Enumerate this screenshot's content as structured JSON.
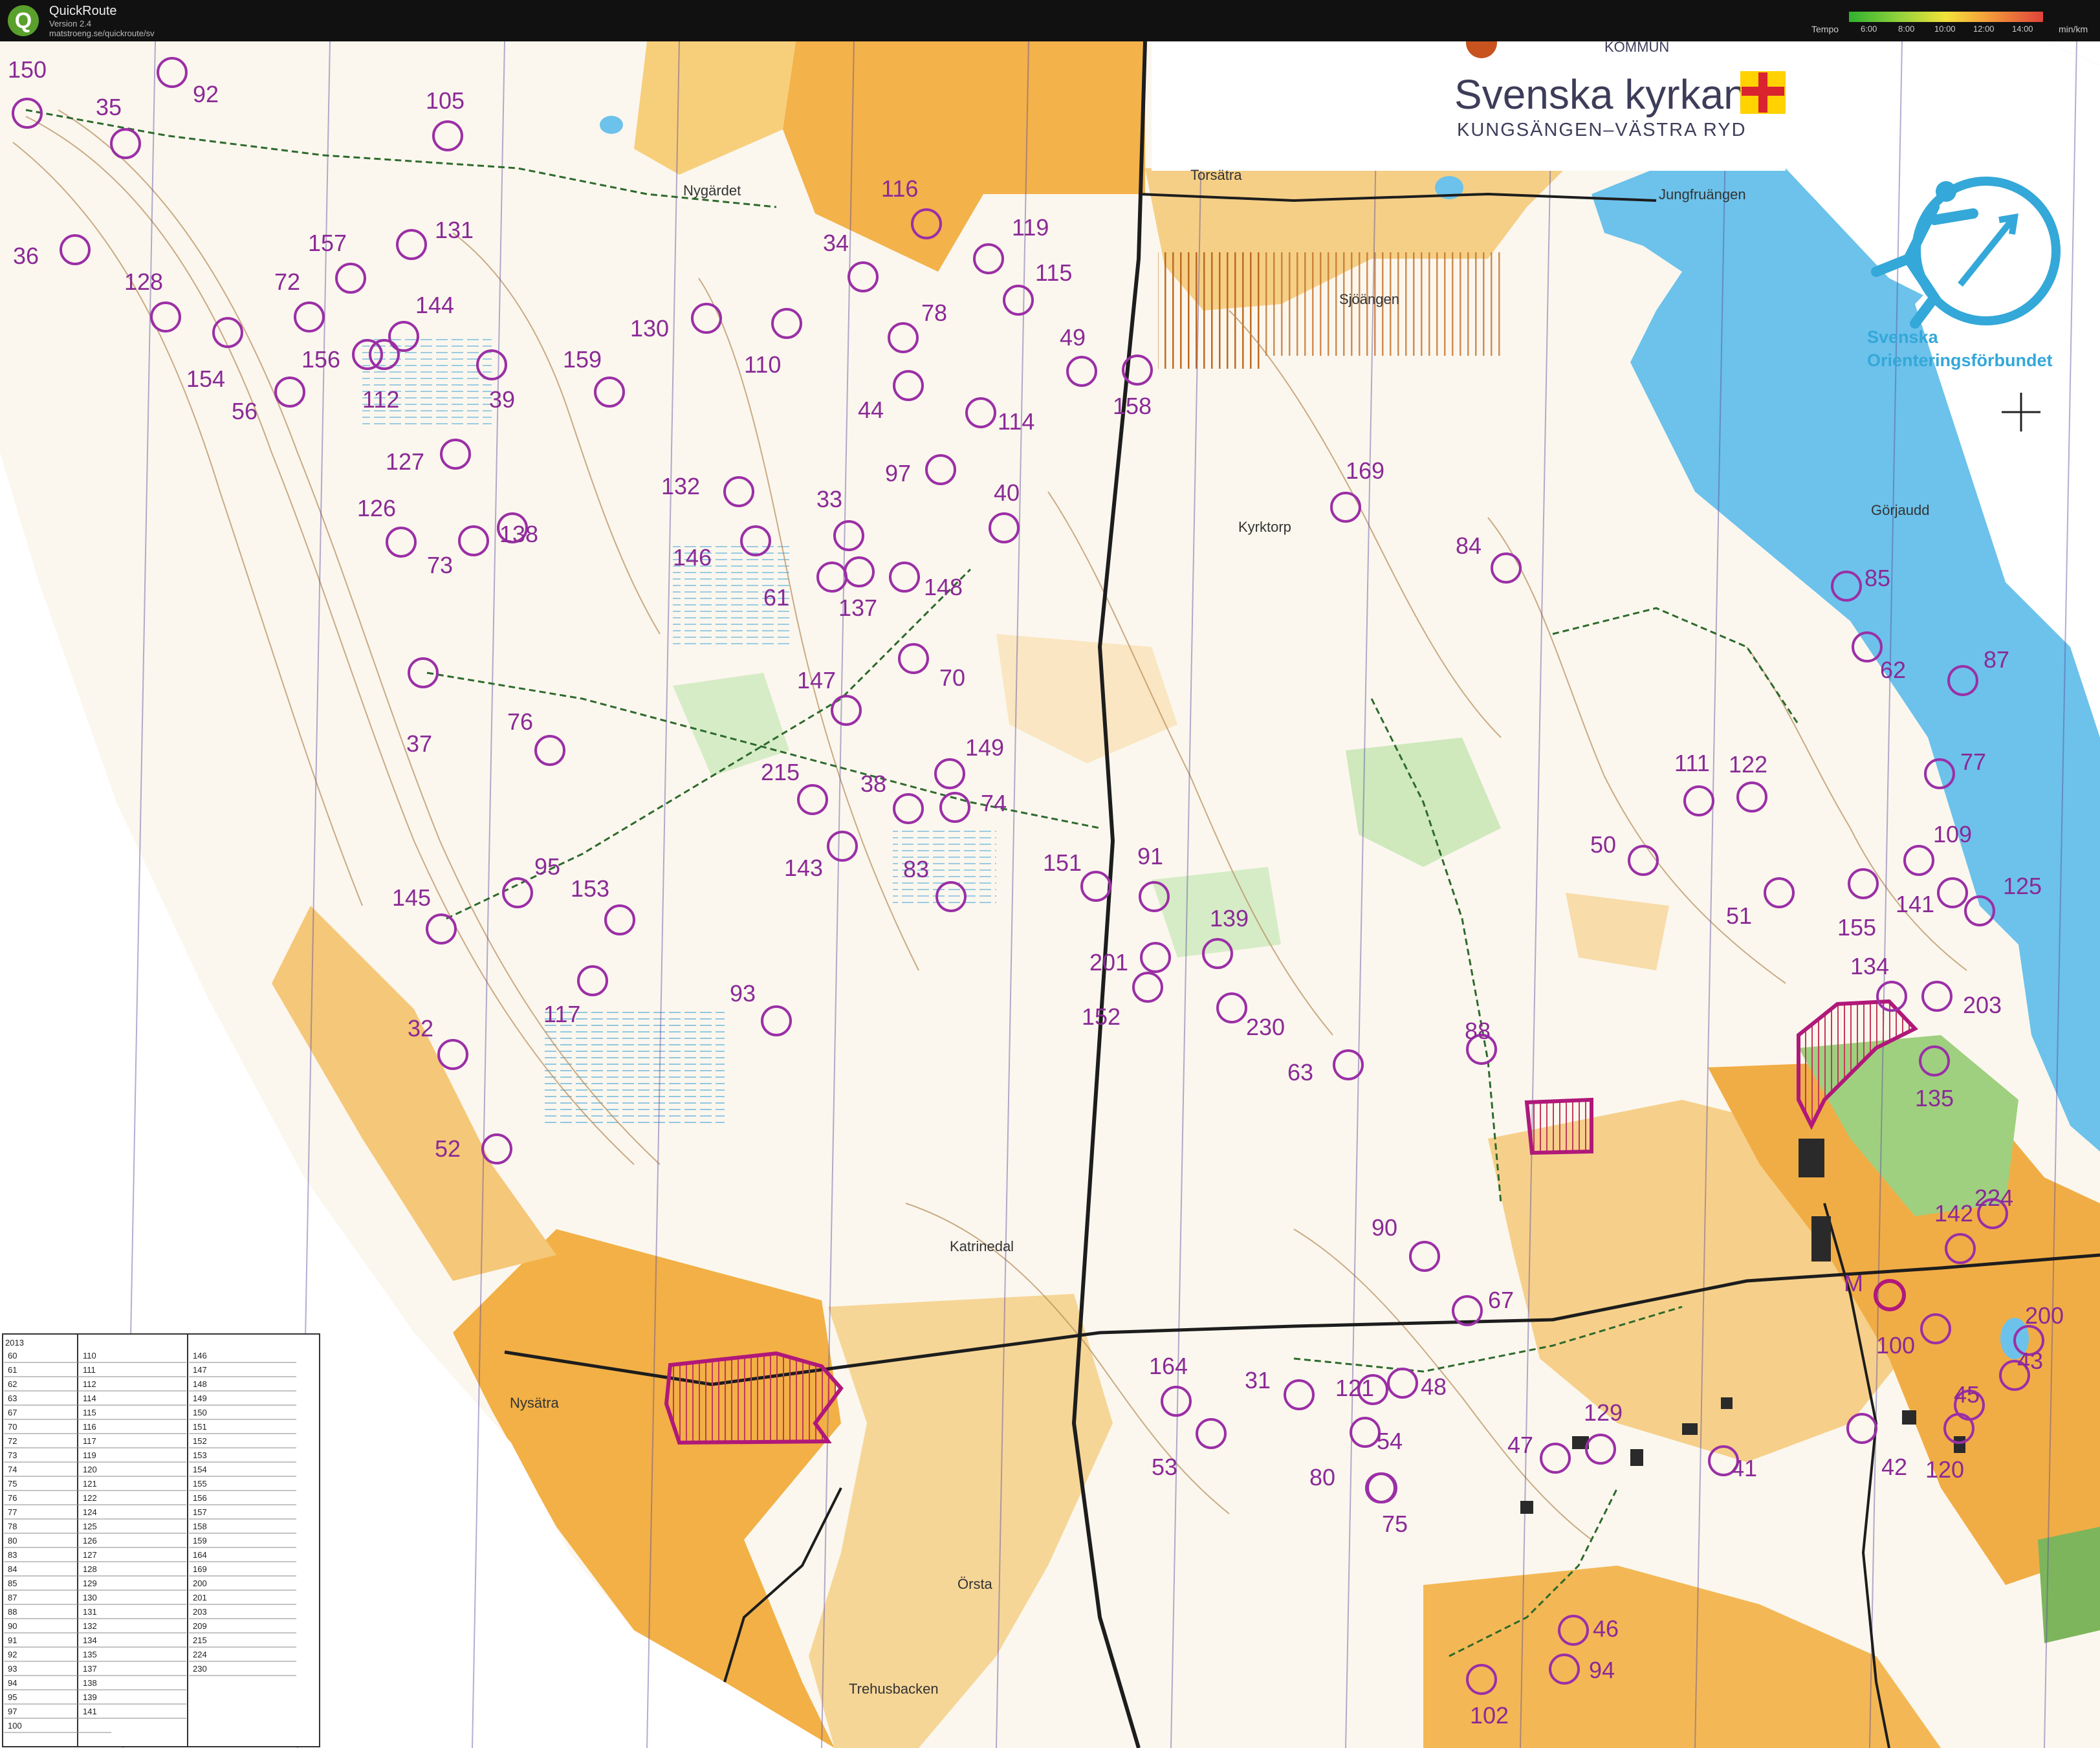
{
  "app": {
    "title": "QuickRoute",
    "version": "Version 2.4",
    "url": "matstroeng.se/quickroute/sv",
    "tempo_label": "Tempo",
    "tempo_ticks": [
      "6:00",
      "8:00",
      "10:00",
      "12:00",
      "14:00"
    ],
    "tempo_unit": "min/km"
  },
  "map": {
    "sponsor": {
      "municipality": "KOMMUN",
      "name": "Svenska kyrkan",
      "parish": "KUNGSÄNGEN–VÄSTRA RYD"
    },
    "federation": {
      "line1": "Svenska",
      "line2": "Orienteringsförbundet"
    },
    "place_names": [
      "Nygärdet",
      "Torsätra",
      "Jungfruängen",
      "Sjöängen",
      "Kyrktorp",
      "Görjaudd",
      "Katrinedal",
      "Nysätra",
      "Örsta",
      "Trehusbacken"
    ],
    "start_finish_label": "M",
    "controls": [
      "150",
      "35",
      "92",
      "105",
      "36",
      "131",
      "157",
      "128",
      "72",
      "144",
      "154",
      "156",
      "112",
      "39",
      "56",
      "159",
      "127",
      "126",
      "73",
      "138",
      "37",
      "76",
      "116",
      "119",
      "34",
      "115",
      "130",
      "110",
      "78",
      "49",
      "158",
      "44",
      "114",
      "97",
      "132",
      "33",
      "40",
      "146",
      "61",
      "137",
      "148",
      "147",
      "70",
      "149",
      "215",
      "38",
      "74",
      "143",
      "83",
      "169",
      "84",
      "85",
      "62",
      "87",
      "111",
      "122",
      "77",
      "50",
      "109",
      "51",
      "141",
      "125",
      "155",
      "134",
      "203",
      "91",
      "151",
      "139",
      "201",
      "152",
      "230",
      "63",
      "88",
      "135",
      "145",
      "95",
      "153",
      "117",
      "93",
      "32",
      "52",
      "90",
      "67",
      "224",
      "142",
      "164",
      "31",
      "121",
      "48",
      "100",
      "200",
      "53",
      "54",
      "129",
      "41",
      "80",
      "47",
      "42",
      "120",
      "45",
      "43",
      "75",
      "46",
      "94",
      "102"
    ],
    "description_sheet": {
      "year": "2013",
      "column1": [
        "60",
        "61",
        "62",
        "63",
        "67",
        "70",
        "72",
        "73",
        "74",
        "75",
        "76",
        "77",
        "78",
        "80",
        "83",
        "84",
        "85",
        "87",
        "88",
        "90",
        "91",
        "92",
        "93",
        "94",
        "95",
        "97",
        "100"
      ],
      "column2": [
        "110",
        "111",
        "112",
        "114",
        "115",
        "116",
        "117",
        "119",
        "120",
        "121",
        "122",
        "124",
        "125",
        "126",
        "127",
        "128",
        "129",
        "130",
        "131",
        "132",
        "134",
        "135",
        "137",
        "138",
        "139",
        "141"
      ],
      "column3": [
        "146",
        "147",
        "148",
        "149",
        "150",
        "151",
        "152",
        "153",
        "154",
        "155",
        "156",
        "157",
        "158",
        "159",
        "164",
        "169",
        "200",
        "201",
        "203",
        "209",
        "215",
        "224",
        "230"
      ]
    }
  }
}
